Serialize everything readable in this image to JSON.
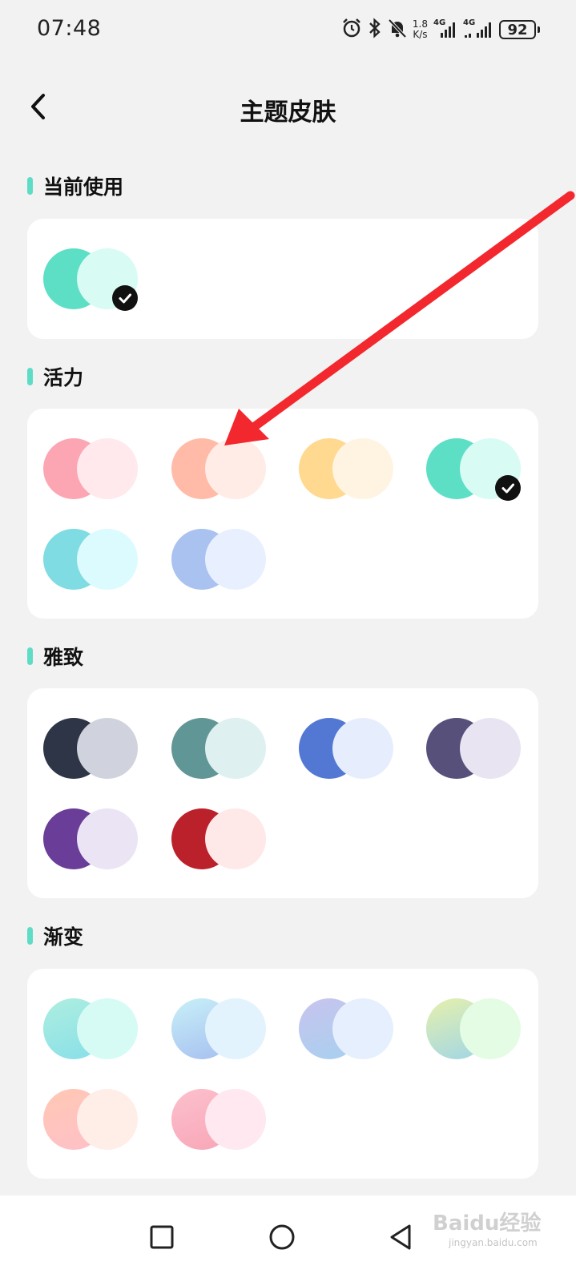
{
  "status_bar": {
    "time": "07:48",
    "speed_value": "1.8",
    "speed_unit": "K/s",
    "network_1": "4G",
    "network_2": "4G",
    "battery": "92",
    "icons": [
      "alarm-icon",
      "bluetooth-icon",
      "mute-icon",
      "signal-icon",
      "signal-icon",
      "battery-icon"
    ]
  },
  "header": {
    "title": "主题皮肤",
    "back_icon": "chevron-left-icon"
  },
  "accent_color": "#5fdcc6",
  "sections": {
    "current": {
      "label": "当前使用",
      "themes": [
        {
          "primary": "#5ddfc6",
          "secondary": "#d8fbf4",
          "selected": true
        }
      ]
    },
    "vitality": {
      "label": "活力",
      "themes": [
        {
          "primary": "#fca6b4",
          "secondary": "#ffe9ec",
          "selected": false
        },
        {
          "primary": "#ffbba8",
          "secondary": "#ffece6",
          "selected": false
        },
        {
          "primary": "#ffd98f",
          "secondary": "#fff4e2",
          "selected": false
        },
        {
          "primary": "#5ddfc6",
          "secondary": "#d8fbf4",
          "selected": true
        },
        {
          "primary": "#7fdce2",
          "secondary": "#dcfbff",
          "selected": false
        },
        {
          "primary": "#a9c2ef",
          "secondary": "#e8f0ff",
          "selected": false
        }
      ]
    },
    "elegant": {
      "label": "雅致",
      "themes": [
        {
          "primary": "#2e3547",
          "secondary": "#d0d3dd",
          "selected": false
        },
        {
          "primary": "#609695",
          "secondary": "#def0f0",
          "selected": false
        },
        {
          "primary": "#5278d4",
          "secondary": "#e6edfd",
          "selected": false
        },
        {
          "primary": "#57507a",
          "secondary": "#e8e4f2",
          "selected": false
        },
        {
          "primary": "#6a3d98",
          "secondary": "#ebe4f4",
          "selected": false
        },
        {
          "primary": "#bb212b",
          "secondary": "#ffe8e8",
          "selected": false
        }
      ]
    },
    "gradient": {
      "label": "渐变",
      "themes": [
        {
          "primary": "#aeeee0",
          "primary_end": "#88dfe8",
          "secondary": "#d6fbf5",
          "selected": false
        },
        {
          "primary": "#c8f0f8",
          "primary_end": "#a6bff0",
          "secondary": "#e2f3fd",
          "selected": false
        },
        {
          "primary": "#c8c4ee",
          "primary_end": "#a8d0ef",
          "secondary": "#e6effd",
          "selected": false
        },
        {
          "primary": "#e6f0ac",
          "primary_end": "#a0d6e6",
          "secondary": "#e4fbe4",
          "selected": false
        },
        {
          "primary": "#ffc8b4",
          "primary_end": "#ffc0c8",
          "secondary": "#ffeee8",
          "selected": false
        },
        {
          "primary": "#fcc0cc",
          "primary_end": "#f8a6b8",
          "secondary": "#ffe8f0",
          "selected": false
        }
      ]
    }
  },
  "nav_bar": {
    "icons": [
      "square-icon",
      "circle-icon",
      "triangle-back-icon"
    ]
  },
  "watermark": {
    "main": "Baidu经验",
    "sub": "jingyan.baidu.com"
  },
  "annotation": {
    "arrow_color": "#f2282e"
  }
}
